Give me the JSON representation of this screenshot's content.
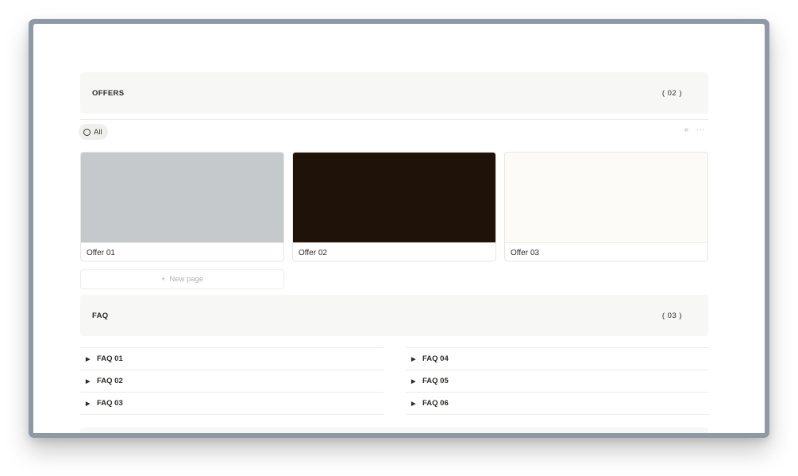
{
  "offers": {
    "title": "OFFERS",
    "count": "( 02 )",
    "view_tab": "All",
    "actions": {
      "collapse": "«",
      "more": "···"
    },
    "cards": [
      {
        "title": "Offer 01",
        "cover_color": "#c6c9cc"
      },
      {
        "title": "Offer 02",
        "cover_color": "#1f1209"
      },
      {
        "title": "Offer 03",
        "cover_color": "#fcfbf7"
      }
    ],
    "new_page": {
      "icon": "+",
      "label": "New page"
    }
  },
  "faq": {
    "title": "FAQ",
    "count": "( 03 )",
    "left": [
      "FAQ 01",
      "FAQ 02",
      "FAQ 03"
    ],
    "right": [
      "FAQ 04",
      "FAQ 05",
      "FAQ 06"
    ],
    "toggle_icon": "▶"
  },
  "colors": {
    "frame": "#8f99a5",
    "section_bg": "#f7f7f5",
    "text": "#37352f"
  }
}
